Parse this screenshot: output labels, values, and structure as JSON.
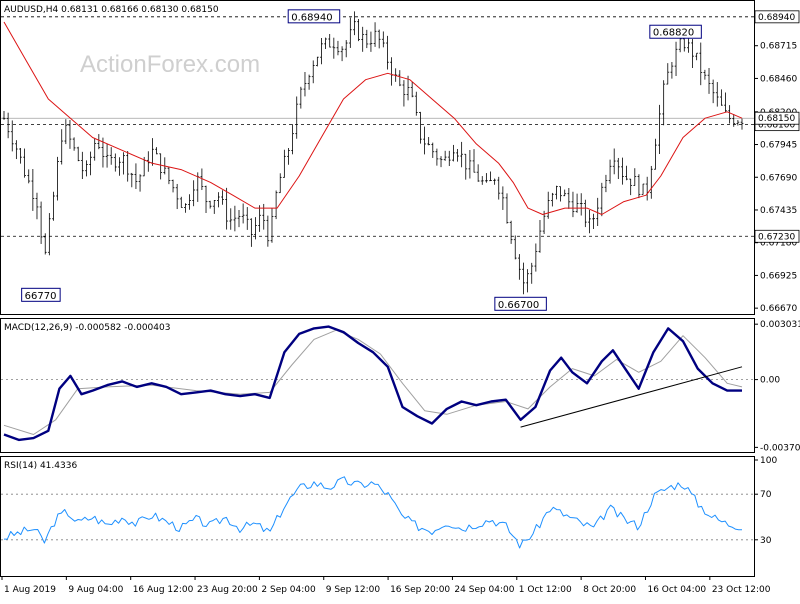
{
  "chart_data": [
    {
      "type": "candlestick",
      "pane": "price",
      "title": "AUDUSD,H4  0.68131 0.68166 0.68130 0.68150",
      "watermark": "ActionForex.com",
      "ylim": [
        0.6664,
        0.6904
      ],
      "yticks": [
        "0.68940",
        "0.68715",
        "0.68460",
        "0.68200",
        "0.67945",
        "0.67690",
        "0.67435",
        "0.67180",
        "0.66925",
        "0.66670"
      ],
      "ytick_values": [
        0.6894,
        0.68715,
        0.6846,
        0.682,
        0.67945,
        0.6769,
        0.67435,
        0.6718,
        0.66925,
        0.6667
      ],
      "levels": [
        {
          "value": 0.6894,
          "label": "0.68940"
        },
        {
          "value": 0.681,
          "label": "0.68100"
        },
        {
          "value": 0.6723,
          "label": "0.67230"
        }
      ],
      "current_price": {
        "value": 0.6815,
        "label": "0.68150"
      },
      "callouts": [
        {
          "text": "0.68940",
          "x_frac": 0.42,
          "value": 0.6894
        },
        {
          "text": "0.68820",
          "x_frac": 0.91,
          "value": 0.6882
        },
        {
          "text": "0.66700",
          "x_frac": 0.7,
          "value": 0.667
        },
        {
          "text": "66770",
          "x_frac": 0.05,
          "value": 0.6677
        }
      ],
      "close_path": [
        [
          0.0,
          0.6815
        ],
        [
          0.015,
          0.6795
        ],
        [
          0.03,
          0.677
        ],
        [
          0.045,
          0.675
        ],
        [
          0.055,
          0.6705
        ],
        [
          0.065,
          0.6745
        ],
        [
          0.08,
          0.681
        ],
        [
          0.095,
          0.679
        ],
        [
          0.11,
          0.677
        ],
        [
          0.125,
          0.68
        ],
        [
          0.14,
          0.678
        ],
        [
          0.16,
          0.6785
        ],
        [
          0.18,
          0.6765
        ],
        [
          0.2,
          0.679
        ],
        [
          0.215,
          0.6775
        ],
        [
          0.23,
          0.676
        ],
        [
          0.245,
          0.6745
        ],
        [
          0.26,
          0.677
        ],
        [
          0.275,
          0.675
        ],
        [
          0.29,
          0.6755
        ],
        [
          0.305,
          0.6735
        ],
        [
          0.32,
          0.674
        ],
        [
          0.335,
          0.6725
        ],
        [
          0.35,
          0.674
        ],
        [
          0.36,
          0.672
        ],
        [
          0.37,
          0.676
        ],
        [
          0.385,
          0.679
        ],
        [
          0.4,
          0.683
        ],
        [
          0.415,
          0.6855
        ],
        [
          0.43,
          0.687
        ],
        [
          0.445,
          0.6875
        ],
        [
          0.46,
          0.687
        ],
        [
          0.475,
          0.6885
        ],
        [
          0.49,
          0.6875
        ],
        [
          0.505,
          0.688
        ],
        [
          0.52,
          0.686
        ],
        [
          0.535,
          0.684
        ],
        [
          0.55,
          0.6835
        ],
        [
          0.565,
          0.68
        ],
        [
          0.58,
          0.679
        ],
        [
          0.595,
          0.678
        ],
        [
          0.61,
          0.6795
        ],
        [
          0.625,
          0.678
        ],
        [
          0.64,
          0.677
        ],
        [
          0.655,
          0.676
        ],
        [
          0.665,
          0.677
        ],
        [
          0.675,
          0.6755
        ],
        [
          0.685,
          0.673
        ],
        [
          0.695,
          0.6705
        ],
        [
          0.705,
          0.6685
        ],
        [
          0.715,
          0.67
        ],
        [
          0.725,
          0.6725
        ],
        [
          0.735,
          0.6745
        ],
        [
          0.75,
          0.676
        ],
        [
          0.765,
          0.675
        ],
        [
          0.78,
          0.6745
        ],
        [
          0.795,
          0.673
        ],
        [
          0.81,
          0.676
        ],
        [
          0.825,
          0.679
        ],
        [
          0.84,
          0.677
        ],
        [
          0.855,
          0.6765
        ],
        [
          0.87,
          0.6755
        ],
        [
          0.88,
          0.679
        ],
        [
          0.895,
          0.684
        ],
        [
          0.905,
          0.686
        ],
        [
          0.92,
          0.6875
        ],
        [
          0.935,
          0.6865
        ],
        [
          0.95,
          0.6845
        ],
        [
          0.965,
          0.683
        ],
        [
          0.98,
          0.6815
        ],
        [
          1.0,
          0.6815
        ]
      ],
      "ma_path": [
        [
          0.0,
          0.689
        ],
        [
          0.03,
          0.686
        ],
        [
          0.06,
          0.683
        ],
        [
          0.09,
          0.6815
        ],
        [
          0.12,
          0.68
        ],
        [
          0.16,
          0.679
        ],
        [
          0.2,
          0.678
        ],
        [
          0.24,
          0.6775
        ],
        [
          0.28,
          0.6765
        ],
        [
          0.31,
          0.6755
        ],
        [
          0.34,
          0.6745
        ],
        [
          0.37,
          0.6745
        ],
        [
          0.4,
          0.677
        ],
        [
          0.43,
          0.68
        ],
        [
          0.46,
          0.683
        ],
        [
          0.49,
          0.6845
        ],
        [
          0.52,
          0.685
        ],
        [
          0.55,
          0.6845
        ],
        [
          0.58,
          0.683
        ],
        [
          0.61,
          0.6815
        ],
        [
          0.64,
          0.6795
        ],
        [
          0.67,
          0.678
        ],
        [
          0.69,
          0.6765
        ],
        [
          0.71,
          0.6745
        ],
        [
          0.73,
          0.674
        ],
        [
          0.76,
          0.6745
        ],
        [
          0.79,
          0.6745
        ],
        [
          0.81,
          0.674
        ],
        [
          0.84,
          0.675
        ],
        [
          0.87,
          0.6755
        ],
        [
          0.89,
          0.677
        ],
        [
          0.92,
          0.68
        ],
        [
          0.95,
          0.6815
        ],
        [
          0.98,
          0.682
        ],
        [
          1.0,
          0.6815
        ]
      ]
    },
    {
      "type": "line",
      "pane": "macd",
      "title": "MACD(12,26,9) -0.000582 -0.000403",
      "ylim": [
        -0.00385,
        0.00315
      ],
      "yticks": [
        "0.003031",
        "0.00",
        "-0.003706"
      ],
      "ytick_values": [
        0.003031,
        0.0,
        -0.003706
      ],
      "zero_level": 0.0,
      "main": [
        [
          0.0,
          -0.003
        ],
        [
          0.02,
          -0.0033
        ],
        [
          0.04,
          -0.0032
        ],
        [
          0.06,
          -0.0028
        ],
        [
          0.075,
          -0.0005
        ],
        [
          0.09,
          0.0002
        ],
        [
          0.105,
          -0.0008
        ],
        [
          0.12,
          -0.0006
        ],
        [
          0.14,
          -0.0003
        ],
        [
          0.16,
          -0.0001
        ],
        [
          0.18,
          -0.0004
        ],
        [
          0.2,
          -0.0002
        ],
        [
          0.22,
          -0.0004
        ],
        [
          0.24,
          -0.0008
        ],
        [
          0.26,
          -0.0007
        ],
        [
          0.28,
          -0.0006
        ],
        [
          0.3,
          -0.0008
        ],
        [
          0.32,
          -0.0009
        ],
        [
          0.34,
          -0.0008
        ],
        [
          0.36,
          -0.001
        ],
        [
          0.38,
          0.0015
        ],
        [
          0.4,
          0.0025
        ],
        [
          0.42,
          0.0028
        ],
        [
          0.44,
          0.0029
        ],
        [
          0.46,
          0.0026
        ],
        [
          0.48,
          0.002
        ],
        [
          0.5,
          0.0015
        ],
        [
          0.52,
          0.0007
        ],
        [
          0.54,
          -0.0015
        ],
        [
          0.56,
          -0.002
        ],
        [
          0.58,
          -0.0024
        ],
        [
          0.6,
          -0.0016
        ],
        [
          0.62,
          -0.0012
        ],
        [
          0.64,
          -0.0014
        ],
        [
          0.66,
          -0.0012
        ],
        [
          0.68,
          -0.0011
        ],
        [
          0.7,
          -0.0022
        ],
        [
          0.72,
          -0.0015
        ],
        [
          0.74,
          0.0005
        ],
        [
          0.755,
          0.0012
        ],
        [
          0.77,
          0.0004
        ],
        [
          0.79,
          -0.0002
        ],
        [
          0.81,
          0.001
        ],
        [
          0.825,
          0.0016
        ],
        [
          0.84,
          0.0007
        ],
        [
          0.86,
          -0.0005
        ],
        [
          0.88,
          0.0015
        ],
        [
          0.9,
          0.0028
        ],
        [
          0.92,
          0.0021
        ],
        [
          0.94,
          0.0006
        ],
        [
          0.96,
          -0.0002
        ],
        [
          0.98,
          -0.0006
        ],
        [
          1.0,
          -0.0006
        ]
      ],
      "signal": [
        [
          0.0,
          -0.0025
        ],
        [
          0.04,
          -0.003
        ],
        [
          0.07,
          -0.0022
        ],
        [
          0.1,
          -0.0005
        ],
        [
          0.14,
          -0.0004
        ],
        [
          0.2,
          -0.0003
        ],
        [
          0.26,
          -0.0006
        ],
        [
          0.32,
          -0.0008
        ],
        [
          0.36,
          -0.0007
        ],
        [
          0.39,
          0.0008
        ],
        [
          0.42,
          0.0022
        ],
        [
          0.45,
          0.0027
        ],
        [
          0.48,
          0.0022
        ],
        [
          0.51,
          0.0014
        ],
        [
          0.54,
          -0.0002
        ],
        [
          0.57,
          -0.0017
        ],
        [
          0.6,
          -0.0019
        ],
        [
          0.64,
          -0.0014
        ],
        [
          0.68,
          -0.0012
        ],
        [
          0.71,
          -0.0016
        ],
        [
          0.74,
          -0.0004
        ],
        [
          0.77,
          0.0006
        ],
        [
          0.8,
          0.0002
        ],
        [
          0.83,
          0.0011
        ],
        [
          0.86,
          0.0004
        ],
        [
          0.89,
          0.001
        ],
        [
          0.92,
          0.0024
        ],
        [
          0.95,
          0.0012
        ],
        [
          0.98,
          -0.0002
        ],
        [
          1.0,
          -0.0004
        ]
      ],
      "trendline": [
        [
          0.7,
          -0.0026
        ],
        [
          1.0,
          0.0007
        ]
      ]
    },
    {
      "type": "line",
      "pane": "rsi",
      "title": "RSI(14) 41.4336",
      "ylim": [
        0,
        100
      ],
      "yticks": [
        "100",
        "70",
        "30"
      ],
      "ytick_values": [
        100,
        70,
        30
      ],
      "levels": [
        70,
        30
      ],
      "values": [
        [
          0.0,
          32
        ],
        [
          0.02,
          36
        ],
        [
          0.04,
          40
        ],
        [
          0.055,
          28
        ],
        [
          0.07,
          48
        ],
        [
          0.085,
          55
        ],
        [
          0.1,
          45
        ],
        [
          0.12,
          50
        ],
        [
          0.14,
          43
        ],
        [
          0.16,
          50
        ],
        [
          0.18,
          44
        ],
        [
          0.2,
          52
        ],
        [
          0.22,
          46
        ],
        [
          0.24,
          40
        ],
        [
          0.26,
          48
        ],
        [
          0.28,
          42
        ],
        [
          0.3,
          50
        ],
        [
          0.32,
          40
        ],
        [
          0.34,
          44
        ],
        [
          0.36,
          36
        ],
        [
          0.38,
          60
        ],
        [
          0.4,
          75
        ],
        [
          0.42,
          80
        ],
        [
          0.44,
          76
        ],
        [
          0.46,
          82
        ],
        [
          0.48,
          78
        ],
        [
          0.5,
          80
        ],
        [
          0.52,
          70
        ],
        [
          0.54,
          50
        ],
        [
          0.56,
          42
        ],
        [
          0.58,
          38
        ],
        [
          0.6,
          46
        ],
        [
          0.62,
          40
        ],
        [
          0.64,
          44
        ],
        [
          0.66,
          48
        ],
        [
          0.68,
          42
        ],
        [
          0.7,
          25
        ],
        [
          0.72,
          38
        ],
        [
          0.74,
          58
        ],
        [
          0.76,
          52
        ],
        [
          0.78,
          45
        ],
        [
          0.8,
          40
        ],
        [
          0.82,
          58
        ],
        [
          0.84,
          48
        ],
        [
          0.86,
          42
        ],
        [
          0.88,
          68
        ],
        [
          0.9,
          76
        ],
        [
          0.92,
          80
        ],
        [
          0.94,
          62
        ],
        [
          0.96,
          50
        ],
        [
          0.98,
          44
        ],
        [
          1.0,
          42
        ]
      ]
    }
  ],
  "xticks": [
    "1 Aug 2019",
    "9 Aug 04:00",
    "16 Aug 12:00",
    "23 Aug 20:00",
    "2 Sep 04:00",
    "9 Sep 12:00",
    "16 Sep 20:00",
    "24 Sep 04:00",
    "1 Oct 12:00",
    "8 Oct 20:00",
    "16 Oct 04:00",
    "23 Oct 12:00"
  ],
  "colors": {
    "candle": "#000000",
    "ma": "#dc1414",
    "macd_main": "#000080",
    "macd_signal": "#a0a0a0",
    "rsi": "#1e90ff",
    "grid_dotted": "#808080",
    "current_line": "#a0a0a0"
  }
}
